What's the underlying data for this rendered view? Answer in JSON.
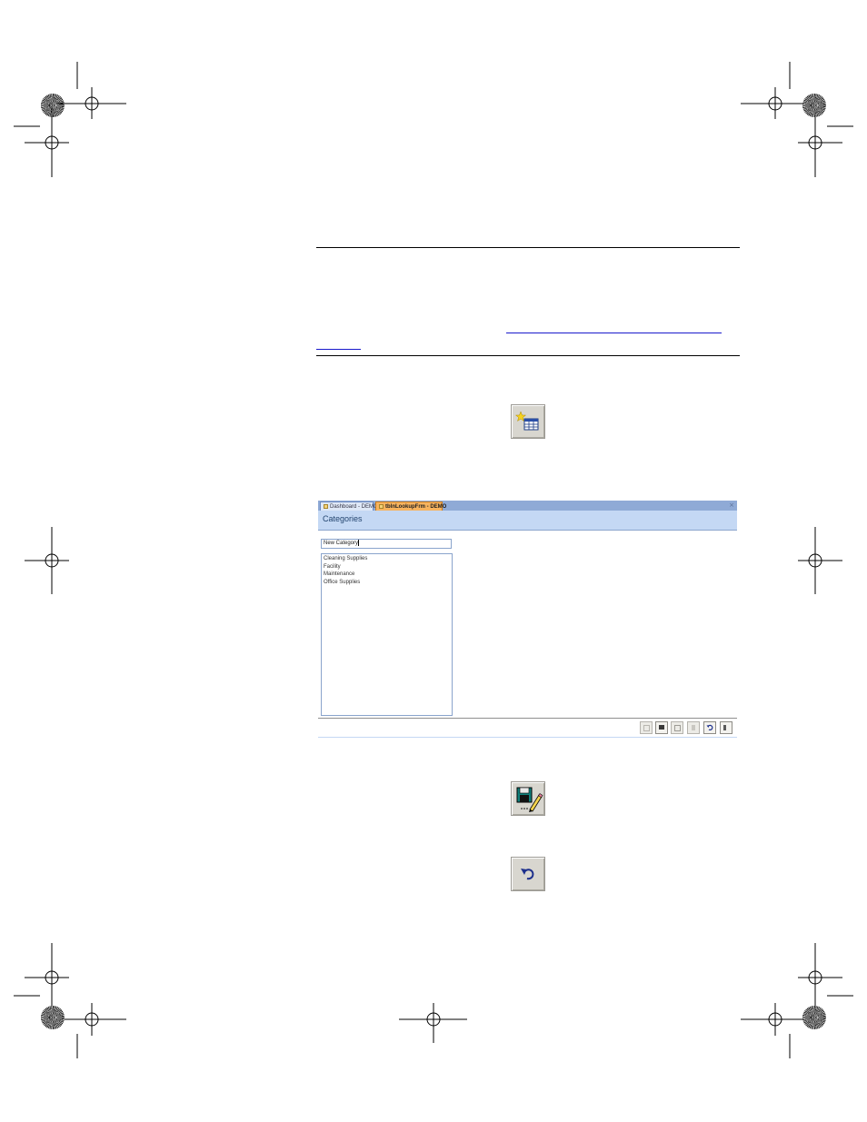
{
  "page": {
    "link_line1": "                                                    ",
    "link_line2": "         "
  },
  "toolbar_icons": {
    "new_record": "new-record-icon",
    "save_edit": "save-edit-icon",
    "undo": "undo-icon"
  },
  "form": {
    "tabs": [
      {
        "label": "Dashboard - DEMO"
      },
      {
        "label": "tblnLookupFrm - DEMO"
      }
    ],
    "close_glyph": "×",
    "title": "Categories",
    "new_category_value": "New Category",
    "list_items": [
      "Cleaning Supplies",
      "Facility",
      "Maintenance",
      "Office Supplies"
    ],
    "footer_buttons": [
      "new-icon",
      "edit-icon",
      "copy-icon",
      "delete-icon",
      "undo-icon",
      "exit-icon"
    ]
  },
  "colors": {
    "tab_bar": "#8faad6",
    "active_tab": "#f7b35e",
    "header": "#c4d8f4",
    "link": "#1a1acc"
  }
}
